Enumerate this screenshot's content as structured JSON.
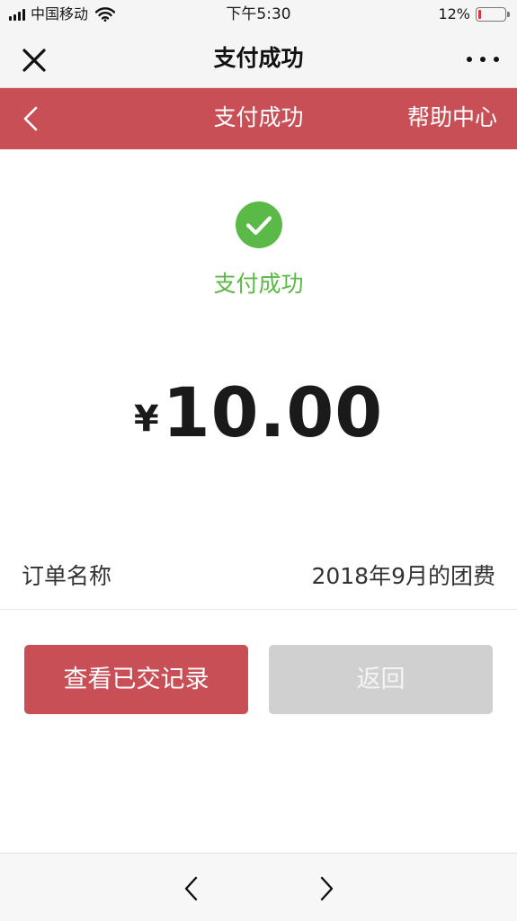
{
  "status_bar": {
    "carrier": "中国移动",
    "time": "下午5:30",
    "battery_percent": "12%",
    "battery_level": 0.12,
    "battery_color": "#e0323a",
    "icons": [
      "signal-icon",
      "wifi-icon",
      "battery-icon"
    ]
  },
  "wechat_nav": {
    "title": "支付成功",
    "icons": [
      "close-icon",
      "more-icon"
    ]
  },
  "page_header": {
    "title": "支付成功",
    "help_label": "帮助中心",
    "background_color": "#c94f57",
    "icons": [
      "back-chevron-icon"
    ]
  },
  "result": {
    "status_text": "支付成功",
    "status_color": "#5ab947",
    "icon": "check-circle-icon",
    "currency_symbol": "¥",
    "amount": "10.00"
  },
  "order": {
    "label": "订单名称",
    "value": "2018年9月的团费"
  },
  "buttons": {
    "view_records": "查看已交记录",
    "back": "返回"
  },
  "bottom_bar": {
    "icons": [
      "nav-back-icon",
      "nav-forward-icon"
    ]
  }
}
